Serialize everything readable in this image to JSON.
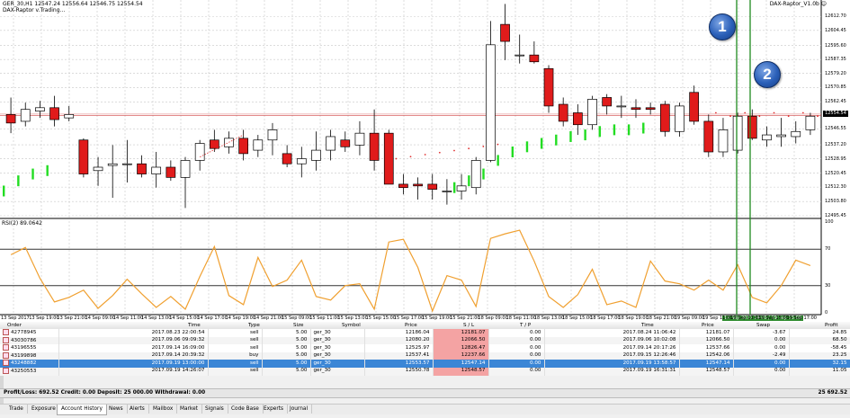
{
  "chart": {
    "title_line": "GER_30,H1  12547.24 12556.64 12546.75 12554.54",
    "subtitle": "DAX-Raptor v.Trading...",
    "ea_label": "DAX-Raptor_V1.0b ☺",
    "indicator_label": "RSI(2) 89.0642",
    "badge_1": "1",
    "badge_2": "2",
    "current_price": "12554.54",
    "highlight_time": "19 Sep 2017 14:00 / 19 Sep 15:00",
    "price_ticks": [
      "12612.70",
      "12604.45",
      "12595.60",
      "12587.35",
      "12579.20",
      "12570.85",
      "12562.45",
      "12546.55",
      "12537.20",
      "12528.95",
      "12520.45",
      "12512.30",
      "12503.80",
      "12495.45"
    ],
    "rsi_ticks": [
      "100",
      "70",
      "30",
      "0"
    ],
    "time_ticks": [
      "13 Sep 2017",
      "13 Sep 19:00",
      "13 Sep 21:00",
      "14 Sep 09:00",
      "14 Sep 11:00",
      "14 Sep 13:00",
      "14 Sep 15:00",
      "14 Sep 17:00",
      "14 Sep 19:00",
      "14 Sep 21:00",
      "15 Sep 09:00",
      "15 Sep 11:00",
      "15 Sep 13:00",
      "15 Sep 15:00",
      "15 Sep 17:00",
      "15 Sep 19:00",
      "15 Sep 21:00",
      "18 Sep 09:00",
      "18 Sep 11:00",
      "18 Sep 13:00",
      "18 Sep 15:00",
      "18 Sep 17:00",
      "18 Sep 19:00",
      "18 Sep 21:00",
      "19 Sep 09:00",
      "19 Sep 11:00",
      "19 Sep 13:00",
      "19 Sep 15:00",
      "19 Sep 17:00"
    ],
    "colors": {
      "up": "#ffffff",
      "down": "#e01b1b",
      "wick": "#000000",
      "signal": "#22dd22",
      "rsi_line": "#f0a030",
      "marker": "#1f8a1f"
    },
    "candles": [
      {
        "o": 12555,
        "h": 12565,
        "l": 12544,
        "c": 12550
      },
      {
        "o": 12551,
        "h": 12562,
        "l": 12548,
        "c": 12558
      },
      {
        "o": 12557,
        "h": 12563,
        "l": 12553,
        "c": 12559
      },
      {
        "o": 12559,
        "h": 12566,
        "l": 12548,
        "c": 12552
      },
      {
        "o": 12553,
        "h": 12560,
        "l": 12551,
        "c": 12555
      },
      {
        "o": 12540,
        "h": 12541,
        "l": 12518,
        "c": 12520
      },
      {
        "o": 12522,
        "h": 12530,
        "l": 12513,
        "c": 12524
      },
      {
        "o": 12525,
        "h": 12537,
        "l": 12506,
        "c": 12526
      },
      {
        "o": 12526,
        "h": 12540,
        "l": 12515,
        "c": 12526
      },
      {
        "o": 12526,
        "h": 12531,
        "l": 12518,
        "c": 12520
      },
      {
        "o": 12520,
        "h": 12533,
        "l": 12512,
        "c": 12524
      },
      {
        "o": 12524,
        "h": 12528,
        "l": 12516,
        "c": 12518
      },
      {
        "o": 12518,
        "h": 12530,
        "l": 12500,
        "c": 12528
      },
      {
        "o": 12528,
        "h": 12540,
        "l": 12522,
        "c": 12538
      },
      {
        "o": 12540,
        "h": 12546,
        "l": 12533,
        "c": 12535
      },
      {
        "o": 12536,
        "h": 12545,
        "l": 12532,
        "c": 12541
      },
      {
        "o": 12541,
        "h": 12546,
        "l": 12528,
        "c": 12532
      },
      {
        "o": 12534,
        "h": 12543,
        "l": 12530,
        "c": 12540
      },
      {
        "o": 12540,
        "h": 12550,
        "l": 12531,
        "c": 12546
      },
      {
        "o": 12532,
        "h": 12537,
        "l": 12524,
        "c": 12526
      },
      {
        "o": 12526,
        "h": 12536,
        "l": 12518,
        "c": 12529
      },
      {
        "o": 12528,
        "h": 12545,
        "l": 12522,
        "c": 12534
      },
      {
        "o": 12534,
        "h": 12546,
        "l": 12528,
        "c": 12542
      },
      {
        "o": 12540,
        "h": 12545,
        "l": 12533,
        "c": 12536
      },
      {
        "o": 12537,
        "h": 12551,
        "l": 12531,
        "c": 12544
      },
      {
        "o": 12544,
        "h": 12558,
        "l": 12522,
        "c": 12528
      },
      {
        "o": 12544,
        "h": 12546,
        "l": 12514,
        "c": 12514
      },
      {
        "o": 12514,
        "h": 12520,
        "l": 12508,
        "c": 12512
      },
      {
        "o": 12514,
        "h": 12518,
        "l": 12505,
        "c": 12513
      },
      {
        "o": 12514,
        "h": 12520,
        "l": 12505,
        "c": 12511
      },
      {
        "o": 12510,
        "h": 12517,
        "l": 12502,
        "c": 12510
      },
      {
        "o": 12510,
        "h": 12520,
        "l": 12505,
        "c": 12513
      },
      {
        "o": 12512,
        "h": 12530,
        "l": 12508,
        "c": 12528
      },
      {
        "o": 12528,
        "h": 12610,
        "l": 12527,
        "c": 12596
      },
      {
        "o": 12608,
        "h": 12620,
        "l": 12587,
        "c": 12598
      },
      {
        "o": 12590,
        "h": 12602,
        "l": 12585,
        "c": 12590
      },
      {
        "o": 12590,
        "h": 12598,
        "l": 12585,
        "c": 12586
      },
      {
        "o": 12582,
        "h": 12584,
        "l": 12556,
        "c": 12560
      },
      {
        "o": 12561,
        "h": 12565,
        "l": 12548,
        "c": 12551
      },
      {
        "o": 12556,
        "h": 12561,
        "l": 12543,
        "c": 12549
      },
      {
        "o": 12549,
        "h": 12566,
        "l": 12546,
        "c": 12564
      },
      {
        "o": 12565,
        "h": 12567,
        "l": 12555,
        "c": 12560
      },
      {
        "o": 12560,
        "h": 12566,
        "l": 12553,
        "c": 12560
      },
      {
        "o": 12559,
        "h": 12564,
        "l": 12553,
        "c": 12558
      },
      {
        "o": 12559,
        "h": 12562,
        "l": 12555,
        "c": 12558
      },
      {
        "o": 12561,
        "h": 12563,
        "l": 12542,
        "c": 12545
      },
      {
        "o": 12545,
        "h": 12562,
        "l": 12542,
        "c": 12560
      },
      {
        "o": 12568,
        "h": 12572,
        "l": 12549,
        "c": 12551
      },
      {
        "o": 12551,
        "h": 12555,
        "l": 12530,
        "c": 12533
      },
      {
        "o": 12533,
        "h": 12553,
        "l": 12530,
        "c": 12546
      },
      {
        "o": 12534,
        "h": 12556,
        "l": 12532,
        "c": 12554
      },
      {
        "o": 12554,
        "h": 12558,
        "l": 12540,
        "c": 12541
      },
      {
        "o": 12540,
        "h": 12548,
        "l": 12536,
        "c": 12543
      },
      {
        "o": 12542,
        "h": 12553,
        "l": 12536,
        "c": 12543
      },
      {
        "o": 12542,
        "h": 12551,
        "l": 12538,
        "c": 12545
      },
      {
        "o": 12546,
        "h": 12556,
        "l": 12543,
        "c": 12554
      }
    ],
    "signals": [
      {
        "i": 0,
        "p": 12510
      },
      {
        "i": 1,
        "p": 12516
      },
      {
        "i": 2,
        "p": 12520
      },
      {
        "i": 3,
        "p": 12522
      },
      {
        "i": 30,
        "p": 12512
      },
      {
        "i": 31,
        "p": 12516
      },
      {
        "i": 32,
        "p": 12520
      },
      {
        "i": 33,
        "p": 12528
      },
      {
        "i": 34,
        "p": 12533
      },
      {
        "i": 35,
        "p": 12536
      },
      {
        "i": 36,
        "p": 12538
      },
      {
        "i": 37,
        "p": 12540
      },
      {
        "i": 38,
        "p": 12542
      },
      {
        "i": 39,
        "p": 12543
      },
      {
        "i": 40,
        "p": 12545
      },
      {
        "i": 41,
        "p": 12546
      },
      {
        "i": 42,
        "p": 12546
      },
      {
        "i": 43,
        "p": 12547
      }
    ],
    "rsi_values": [
      64,
      72,
      38,
      12,
      17,
      25,
      5,
      19,
      37,
      21,
      6,
      18,
      4,
      40,
      73,
      19,
      9,
      61,
      29,
      36,
      58,
      18,
      14,
      30,
      32,
      4,
      78,
      81,
      50,
      2,
      41,
      36,
      7,
      82,
      87,
      91,
      57,
      18,
      6,
      20,
      48,
      9,
      13,
      6,
      57,
      35,
      32,
      25,
      36,
      25,
      53,
      17,
      11,
      30,
      58,
      52
    ]
  },
  "trades": {
    "headers": [
      "Order",
      "Time",
      "Type",
      "Size",
      "Symbol",
      "Price",
      "S / L",
      "T / P",
      "Time",
      "Price",
      "Swap",
      "Profit"
    ],
    "rows": [
      [
        "42778945",
        "2017.08.23 22:00:54",
        "sell",
        "5.00",
        "ger_30",
        "12186.04",
        "12181.07",
        "0.00",
        "2017.08.24 11:06:42",
        "12181.07",
        "-3.67",
        "24.85"
      ],
      [
        "43030786",
        "2017.09.06 09:09:32",
        "sell",
        "5.00",
        "ger_30",
        "12080.20",
        "12066.50",
        "0.00",
        "2017.09.06 10:02:08",
        "12066.50",
        "0.00",
        "68.50"
      ],
      [
        "43196555",
        "2017.09.14 16:09:00",
        "sell",
        "5.00",
        "ger_30",
        "12525.97",
        "12826.47",
        "0.00",
        "2017.09.14 20:17:26",
        "12537.66",
        "0.00",
        "-58.45"
      ],
      [
        "43199898",
        "2017.09.14 20:39:32",
        "buy",
        "5.00",
        "ger_30",
        "12537.41",
        "12237.66",
        "0.00",
        "2017.09.15 12:26:46",
        "12542.06",
        "-2.49",
        "23.25"
      ],
      [
        "43248882",
        "2017.09.19 13:00:00",
        "sell",
        "5.00",
        "ger_30",
        "12553.57",
        "12547.14",
        "0.00",
        "2017.09.19 13:58:57",
        "12547.14",
        "0.00",
        "32.15"
      ],
      [
        "43250553",
        "2017.09.19 14:26:07",
        "sell",
        "5.00",
        "ger_30",
        "12550.78",
        "12548.57",
        "0.00",
        "2017.09.19 16:31:31",
        "12548.57",
        "0.00",
        "11.05"
      ]
    ],
    "summary_left": "Profit/Loss: 692.52  Credit: 0.00  Deposit: 25 000.00  Withdrawal: 0.00",
    "summary_right": "25 692.52"
  },
  "tabs": [
    "Trade",
    "Exposure",
    "Account History",
    "News",
    "Alerts",
    "Mailbox",
    "Market",
    "Signals",
    "Code Base",
    "Experts",
    "Journal"
  ],
  "active_tab": "Account History"
}
